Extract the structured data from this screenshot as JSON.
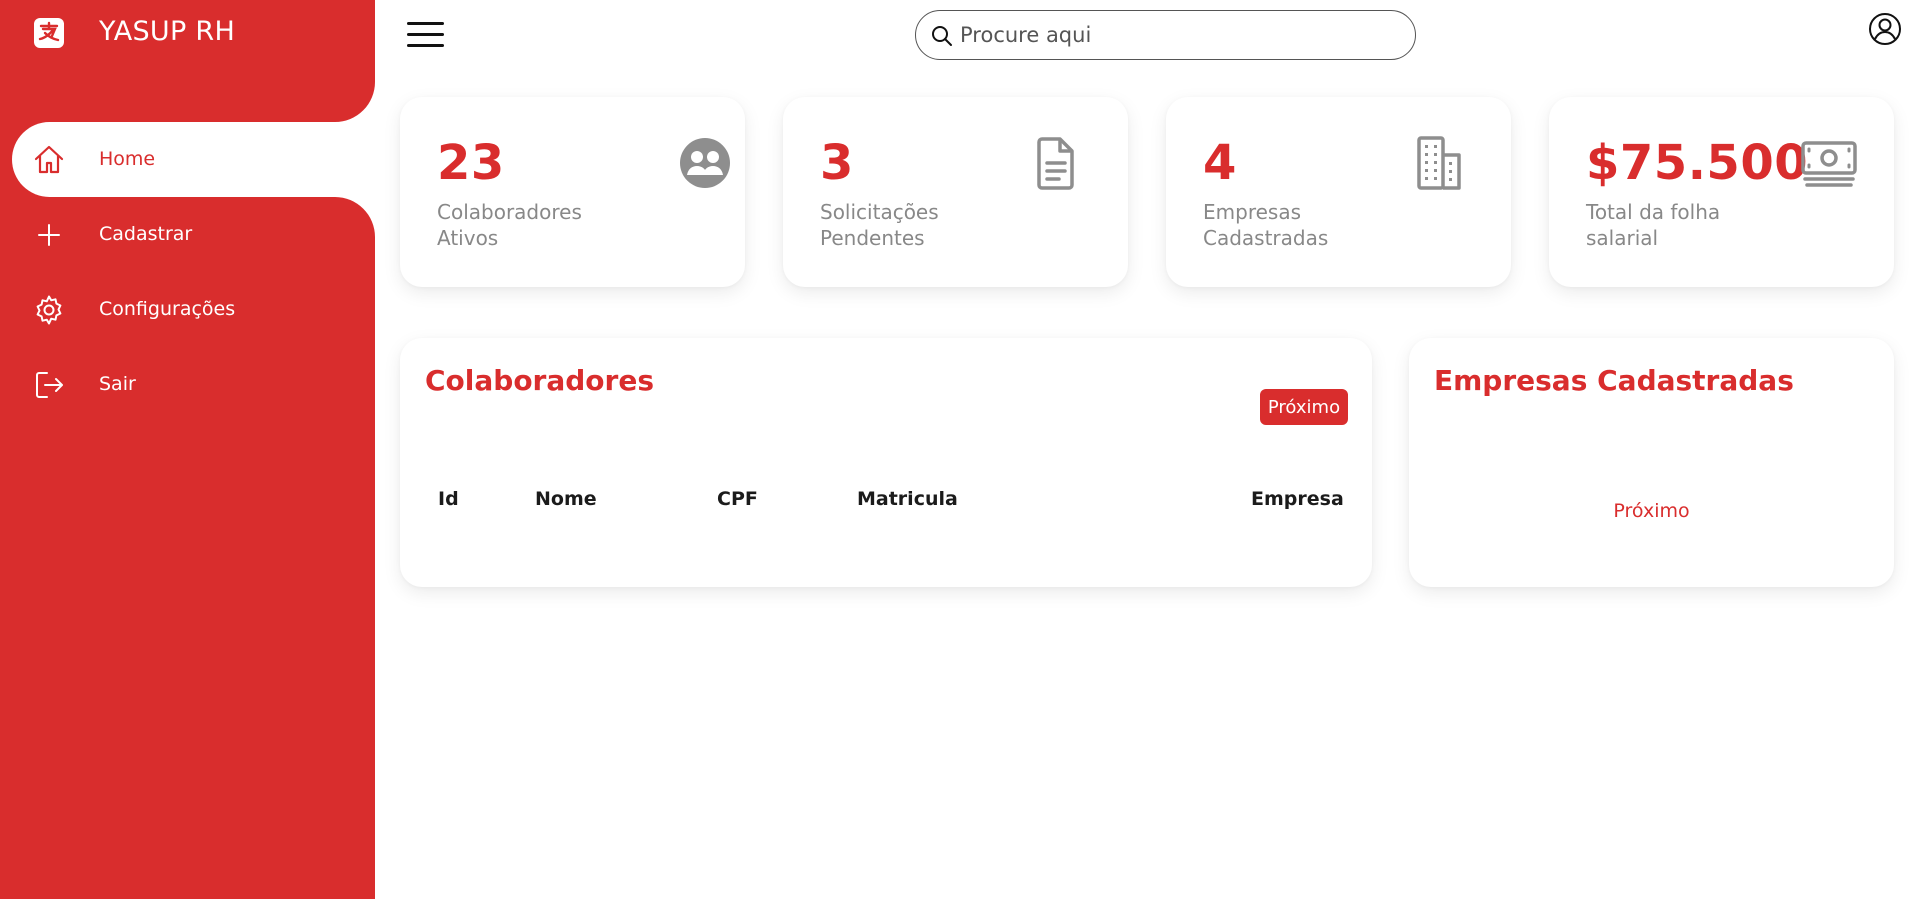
{
  "brand": {
    "title": "YASUP RH",
    "logo_icon": "alipay-logo-icon"
  },
  "sidebar": {
    "items": [
      {
        "label": "Home",
        "icon": "home-icon",
        "active": true
      },
      {
        "label": "Cadastrar",
        "icon": "plus-icon",
        "active": false
      },
      {
        "label": "Configurações",
        "icon": "gear-icon",
        "active": false
      },
      {
        "label": "Sair",
        "icon": "logout-icon",
        "active": false
      }
    ]
  },
  "header": {
    "menu_icon": "hamburger-menu-icon",
    "search": {
      "placeholder": "Procure aqui",
      "value": "",
      "icon": "search-icon"
    },
    "user_icon": "user-circle-icon"
  },
  "stats": [
    {
      "value": "23",
      "label": "Colaboradores Ativos",
      "icon": "people-icon"
    },
    {
      "value": "3",
      "label": "Solicitações Pendentes",
      "icon": "document-icon"
    },
    {
      "value": "4",
      "label": "Empresas Cadastradas",
      "icon": "building-icon"
    },
    {
      "value": "$75.500",
      "label": "Total da folha salarial",
      "icon": "cash-icon"
    }
  ],
  "colaboradores": {
    "title": "Colaboradores",
    "next_label": "Próximo",
    "columns": [
      "Id",
      "Nome",
      "CPF",
      "Matricula",
      "Empresa"
    ]
  },
  "empresas": {
    "title": "Empresas Cadastradas",
    "next_label": "Próximo"
  },
  "colors": {
    "primary": "#d92d2d",
    "muted_text": "#888888",
    "icon_gray": "#8e8e8e",
    "background": "#ffffff"
  }
}
